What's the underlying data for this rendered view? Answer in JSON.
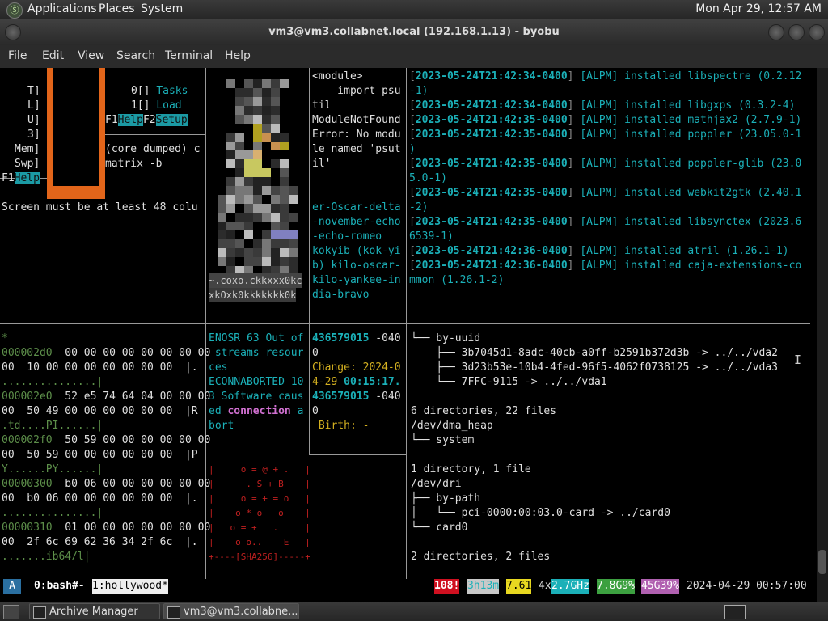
{
  "top_panel": {
    "applications": "Applications",
    "places": "Places",
    "system": "System",
    "clock": "Mon Apr 29, 12:57 AM"
  },
  "window": {
    "title": "vm3@vm3.collabnet.local (192.168.1.13) - byobu"
  },
  "menu": [
    "File",
    "Edit",
    "View",
    "Search",
    "Terminal",
    "Help"
  ],
  "pane_top_left": {
    "labels": [
      "T]",
      "L]",
      "U]",
      "3]",
      "Mem]",
      "Swp]"
    ],
    "tasks": [
      "0[] Tasks",
      "1[] Load"
    ],
    "f1": "F1",
    "help": "Help",
    "f2": "F2",
    "setup": "Setup",
    "core_dumped": "(core dumped) c",
    "matrix": "matrix -b",
    "help2": "Help",
    "screen_msg": "Screen must be at least 48 colu"
  },
  "pane_art": {
    "row_a": "~.coxo.ckkxxx0kc",
    "row_b": "xkOxk0kkkkkkk0k"
  },
  "pane_python": {
    "lines": [
      "<module>",
      "    import psu",
      "til",
      "ModuleNotFound",
      "Error: No modu",
      "le named 'psut",
      "il'"
    ],
    "names": [
      "er-Oscar-delta",
      "-november-echo",
      "-echo-romeo",
      "kokyib (kok-yi",
      "b) kilo-oscar-",
      "kilo-yankee-in",
      "dia-bravo"
    ]
  },
  "pane_log": {
    "entries": [
      {
        "ts": "2023-05-24T21:42:34-0400",
        "src": "[ALPM]",
        "msg": "installed libspectre (0.2.12",
        "cont": "-1)"
      },
      {
        "ts": "2023-05-24T21:42:34-0400",
        "src": "[ALPM]",
        "msg": "installed libgxps (0.3.2-4)",
        "cont": ""
      },
      {
        "ts": "2023-05-24T21:42:35-0400",
        "src": "[ALPM]",
        "msg": "installed mathjax2 (2.7.9-1)",
        "cont": ""
      },
      {
        "ts": "2023-05-24T21:42:35-0400",
        "src": "[ALPM]",
        "msg": "installed poppler (23.05.0-1",
        "cont": ")"
      },
      {
        "ts": "2023-05-24T21:42:35-0400",
        "src": "[ALPM]",
        "msg": "installed poppler-glib (23.0",
        "cont": "5.0-1)"
      },
      {
        "ts": "2023-05-24T21:42:35-0400",
        "src": "[ALPM]",
        "msg": "installed webkit2gtk (2.40.1",
        "cont": "-2)"
      },
      {
        "ts": "2023-05-24T21:42:35-0400",
        "src": "[ALPM]",
        "msg": "installed libsynctex (2023.6",
        "cont": "6539-1)"
      },
      {
        "ts": "2023-05-24T21:42:36-0400",
        "src": "[ALPM]",
        "msg": "installed atril (1.26.1-1)",
        "cont": ""
      },
      {
        "ts": "2023-05-24T21:42:36-0400",
        "src": "[ALPM]",
        "msg": "installed caja-extensions-co",
        "cont": "mmon (1.26.1-2)"
      }
    ]
  },
  "pane_hex": {
    "star": "*",
    "rows": [
      {
        "addr": "000002d0",
        "a": "  00 00 00 00 00 00 00 00",
        "b": "00  10 00 00 00 00 00 00 00  |.",
        "c": "...............|"
      },
      {
        "addr": "000002e0",
        "a": "  52 e5 74 64 04 00 00 00",
        "b": "00  50 49 00 00 00 00 00 00  |R",
        "c": ".td....PI......|"
      },
      {
        "addr": "000002f0",
        "a": "  50 59 00 00 00 00 00 00",
        "b": "00  50 59 00 00 00 00 00 00  |P",
        "c": "Y......PY......|"
      },
      {
        "addr": "00000300",
        "a": "  b0 06 00 00 00 00 00 00",
        "b": "00  b0 06 00 00 00 00 00 00  |.",
        "c": "...............|"
      },
      {
        "addr": "00000310",
        "a": "  01 00 00 00 00 00 00 00",
        "b": "00  2f 6c 69 62 36 34 2f 6c  |.",
        "c": ".......ib64/l|"
      }
    ]
  },
  "pane_errno": {
    "l1": "ENOSR 63 Out of",
    "l2": " streams resour",
    "l3": "ces",
    "l4": "ECONNABORTED 10",
    "l5": "3 Software caus",
    "l6a": "ed ",
    "l6b": "connection",
    "l6c": " a",
    "l7": "bort"
  },
  "pane_stat": {
    "l1": "436579015",
    "l1b": " -040",
    "l2": "0",
    "l3": "Change: 2024-0",
    "l4a": "4-29 ",
    "l4b": "00:15:17.",
    "l5": "436579015",
    "l5b": " -040",
    "l6": "0",
    "l7": " Birth: -"
  },
  "pane_randomart": {
    "lines": [
      "|     o = @ + .   |",
      "|      . S + B    |",
      "|     o = + = o   |",
      "|    o * o   o    |",
      "|   o = +   .     |",
      "|    o o..    E   |",
      "+----[SHA256]-----+"
    ]
  },
  "pane_tree": {
    "lines": [
      "└── by-uuid",
      "    ├── 3b7045d1-8adc-40cb-a0ff-b2591b372d3b -> ../../vda2",
      "    ├── 3d23b53e-10b4-4fed-96f5-4062f0738125 -> ../../vda3",
      "    └── 7FFC-9115 -> ../../vda1",
      "",
      "6 directories, 22 files",
      "/dev/dma_heap",
      "└── system",
      "",
      "1 directory, 1 file",
      "/dev/dri",
      "├── by-path",
      "│   └── pci-0000:00:03.0-card -> ../card0",
      "└── card0",
      "",
      "2 directories, 2 files"
    ]
  },
  "status_bar": {
    "a": "A",
    "win0": "0:bash#-",
    "win1": "1:hollywood*",
    "updates": "108!",
    "uptime": "3h13m",
    "load": "7.61",
    "cpu_count": "4x",
    "cpu_freq": "2.7GHz",
    "mem": "7.8G9%",
    "disk": "45G39%",
    "datetime": "2024-04-29 00:57:00",
    "colors": {
      "updates": "#d01020",
      "uptime": "#c8c8c8",
      "load": "#e8d820",
      "cpu": "#1bb0b8",
      "mem": "#3ca040",
      "disk": "#b060b0"
    }
  },
  "taskbar": {
    "items": [
      "Archive Manager",
      "vm3@vm3.collabne..."
    ]
  }
}
